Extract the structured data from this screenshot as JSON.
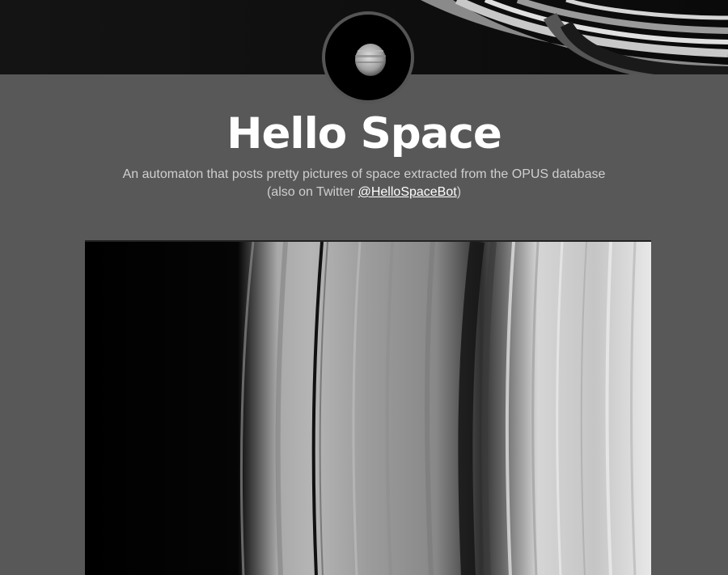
{
  "header": {
    "title": "Hello Space",
    "tagline": "An automaton that posts pretty pictures of space extracted from the OPUS database",
    "twitter_prefix": "(also on Twitter ",
    "twitter_handle": "@HelloSpaceBot",
    "twitter_suffix": ")"
  },
  "icons": {
    "avatar": "planet-icon"
  },
  "colors": {
    "background": "#585858",
    "title": "#ffffff",
    "tagline": "#cfcfcf",
    "banner": "#0b0b0b"
  }
}
